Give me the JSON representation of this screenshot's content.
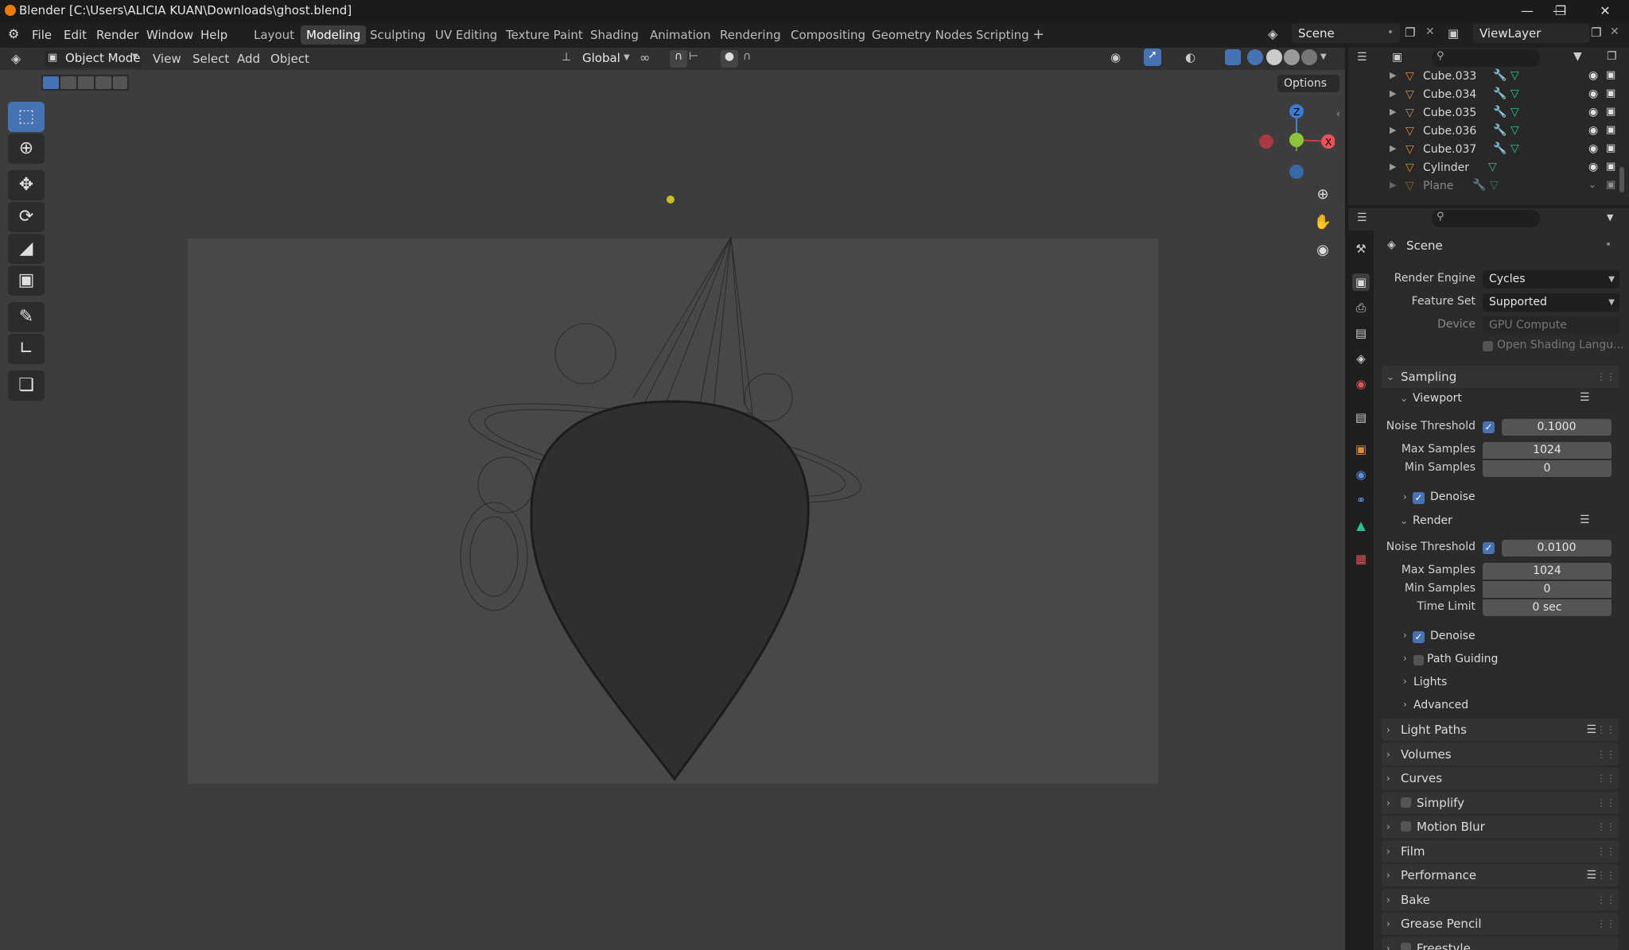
{
  "titlebar": {
    "title": "Blender [C:\\Users\\ALICIA KUAN\\Downloads\\ghost.blend]"
  },
  "menus": [
    "File",
    "Edit",
    "Render",
    "Window",
    "Help"
  ],
  "workspaces": [
    "Layout",
    "Modeling",
    "Sculpting",
    "UV Editing",
    "Texture Paint",
    "Shading",
    "Animation",
    "Rendering",
    "Compositing",
    "Geometry Nodes",
    "Scripting"
  ],
  "scene_field": "Scene",
  "viewlayer_field": "ViewLayer",
  "viewport": {
    "mode": "Object Mode",
    "menus": [
      "View",
      "Select",
      "Add",
      "Object"
    ],
    "orientation": "Global",
    "options": "Options"
  },
  "outliner": {
    "rows": [
      {
        "name": "Cube.033"
      },
      {
        "name": "Cube.034"
      },
      {
        "name": "Cube.035"
      },
      {
        "name": "Cube.036"
      },
      {
        "name": "Cube.037"
      },
      {
        "name": "Cylinder"
      },
      {
        "name": "Plane"
      }
    ]
  },
  "properties": {
    "context": "Scene",
    "render_engine_label": "Render Engine",
    "render_engine": "Cycles",
    "feature_set_label": "Feature Set",
    "feature_set": "Supported",
    "device_label": "Device",
    "device": "GPU Compute",
    "osl_label": "Open Shading Langu...",
    "sampling": "Sampling",
    "viewport": "Viewport",
    "noise_threshold": "Noise Threshold",
    "vp_noise": "0.1000",
    "max_samples": "Max Samples",
    "vp_max": "1024",
    "min_samples": "Min Samples",
    "vp_min": "0",
    "denoise": "Denoise",
    "render": "Render",
    "r_noise": "0.0100",
    "r_max": "1024",
    "r_min": "0",
    "time_limit": "Time Limit",
    "r_time": "0 sec",
    "path_guiding": "Path Guiding",
    "lights": "Lights",
    "advanced": "Advanced",
    "panels": [
      "Light Paths",
      "Volumes",
      "Curves",
      "Simplify",
      "Motion Blur",
      "Film",
      "Performance",
      "Bake",
      "Grease Pencil",
      "Freestyle"
    ]
  },
  "colors": {
    "accent": "#4772b3",
    "object_icon": "#e08a3c",
    "mesh_icon": "#27c39a"
  }
}
